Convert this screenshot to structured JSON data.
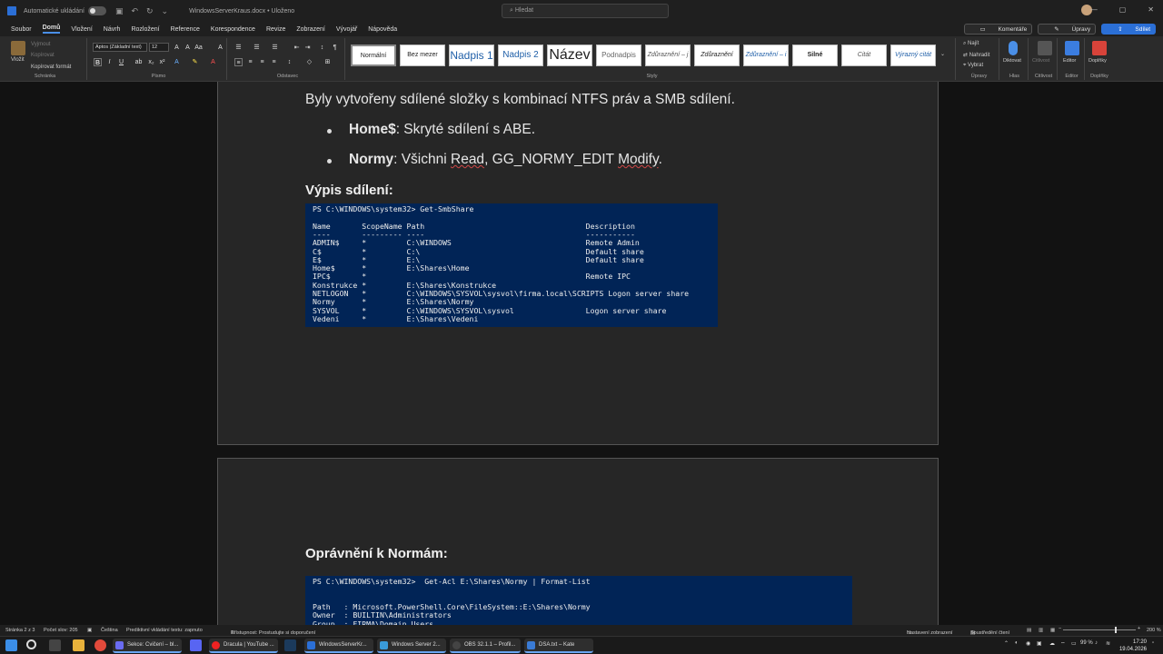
{
  "titlebar": {
    "autosave_label": "Automatické ukládání",
    "document_name": "WindowsServerKraus.docx • Uloženo",
    "search_placeholder": "Hledat"
  },
  "menu": {
    "file": "Soubor",
    "home": "Domů",
    "insert": "Vložení",
    "design": "Návrh",
    "layout": "Rozložení",
    "references": "Reference",
    "mailings": "Korespondence",
    "review": "Revize",
    "view": "Zobrazení",
    "developer": "Vývojář",
    "help": "Nápověda",
    "comments": "Komentáře",
    "editing": "Úpravy",
    "share": "Sdílet"
  },
  "ribbon": {
    "paste": "Vložit",
    "cut": "Vyjmout",
    "copy": "Kopírovat",
    "format_painter": "Kopírovat formát",
    "clipboard_label": "Schránka",
    "font_name": "Aptos (Základní text)",
    "font_size": "12",
    "font_label": "Písmo",
    "paragraph_label": "Odstavec",
    "styles_label": "Styly",
    "styles": [
      "Normální",
      "Bez mezer",
      "Nadpis 1",
      "Nadpis 2",
      "Název",
      "Podnadpis",
      "Zdůraznění – j",
      "Zdůraznění",
      "Zdůraznění – i",
      "Silné",
      "Citát",
      "Výrazný citát"
    ],
    "find": "Najít",
    "replace": "Nahradit",
    "select": "Vybrat",
    "editing_label": "Úpravy",
    "dictate": "Diktovat",
    "voice_label": "Hlas",
    "sensitivity": "Citlivost",
    "sensitivity_label": "Citlivost",
    "editor": "Editor",
    "editor_label": "Editor",
    "addins": "Doplňky",
    "addins_label": "Doplňky"
  },
  "document": {
    "intro": "Byly vytvořeny sdílené složky s kombinací NTFS práv a SMB sdílení.",
    "bullet1_bold": "Home$",
    "bullet1_text": ": Skryté sdílení s ABE.",
    "bullet2_bold": "Normy",
    "bullet2_pre": ": Všichni ",
    "bullet2_read": "Read",
    "bullet2_mid": ", GG_NORMY_EDIT ",
    "bullet2_modify": "Modify",
    "bullet2_end": ".",
    "heading_shares": "Výpis sdílení:",
    "terminal1": [
      "PS C:\\WINDOWS\\system32> Get-SmbShare",
      "",
      "Name       ScopeName Path                                    Description",
      "----       --------- ----                                    -----------",
      "ADMIN$     *         C:\\WINDOWS                              Remote Admin",
      "C$         *         C:\\                                     Default share",
      "E$         *         E:\\                                     Default share",
      "Home$      *         E:\\Shares\\Home",
      "IPC$       *                                                 Remote IPC",
      "Konstrukce *         E:\\Shares\\Konstrukce",
      "NETLOGON   *         C:\\WINDOWS\\SYSVOL\\sysvol\\firma.local\\SCRIPTS Logon server share",
      "Normy      *         E:\\Shares\\Normy",
      "SYSVOL     *         C:\\WINDOWS\\SYSVOL\\sysvol                Logon server share",
      "Vedeni     *         E:\\Shares\\Vedeni"
    ],
    "heading_perms": "Oprávnění k Normám:",
    "terminal2": [
      "PS C:\\WINDOWS\\system32>  Get-Acl E:\\Shares\\Normy | Format-List",
      "",
      "",
      "Path   : Microsoft.PowerShell.Core\\FileSystem::E:\\Shares\\Normy",
      "Owner  : BUILTIN\\Administrators",
      "Group  : FIRMA\\Domain Users"
    ]
  },
  "statusbar": {
    "page": "Stránka 2 z 3",
    "words": "Počet slov: 205",
    "language": "Čeština",
    "predictive": "Prediktivní vkládání textu: zapnuto",
    "accessibility": "Přístupnost: Prostudujte si doporučení",
    "display_settings": "Nastavení zobrazení",
    "focus": "Soustředění čtení",
    "zoom": "200 %"
  },
  "taskbar": {
    "apps": [
      "Sekce: Cvičení – bl...",
      "Dracula | YouTube ...",
      "WindowsServerKr...",
      "Windows Server 2...",
      "OBS 32.1.1 – Profil...",
      "DSA.txt – Kate"
    ],
    "battery": "99 %",
    "time": "17:20",
    "date": "19.04.2026"
  },
  "colors": {
    "terminal_bg": "#012456",
    "accent": "#2b6fd6",
    "page_bg": "#262626"
  }
}
